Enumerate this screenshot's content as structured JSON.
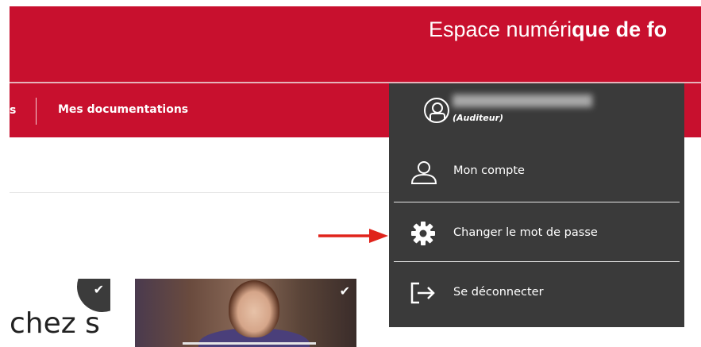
{
  "header": {
    "title_regular": "Espace numéri",
    "title_bold": "que de fo"
  },
  "nav": {
    "prev_item": "s",
    "item": "Mes documentations"
  },
  "cards": [
    {
      "text": "chez s",
      "check": "✔"
    },
    {
      "check": "✔"
    }
  ],
  "user_menu": {
    "role": "(Auditeur)",
    "items": [
      {
        "label": "Mon compte",
        "icon": "user-icon"
      },
      {
        "label": "Changer le mot de passe",
        "icon": "gear-icon"
      },
      {
        "label": "Se déconnecter",
        "icon": "logout-icon"
      }
    ]
  },
  "colors": {
    "brand_red": "#c8102e",
    "menu_bg": "#3a3a3a",
    "annotation_arrow": "#e0231b"
  }
}
